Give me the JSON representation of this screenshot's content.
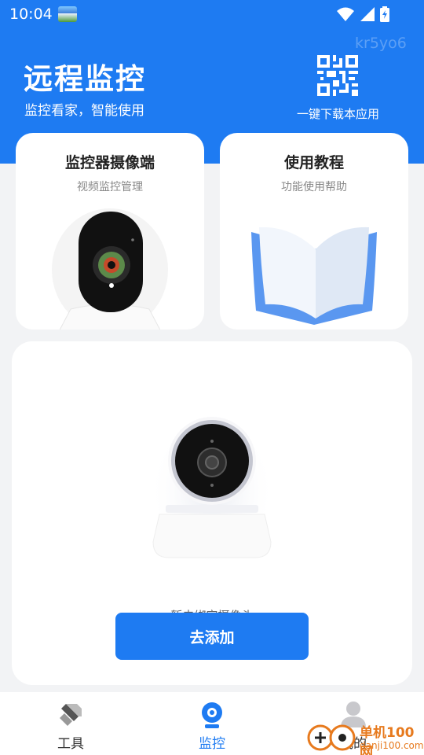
{
  "status_bar": {
    "time": "10:04"
  },
  "watermark_id": "kr5yo6",
  "hero": {
    "title": "远程监控",
    "subtitle": "监控看家，智能使用",
    "qr_label": "一键下载本应用"
  },
  "cards": [
    {
      "title": "监控器摄像端",
      "subtitle": "视频监控管理",
      "icon": "camera-icon"
    },
    {
      "title": "使用教程",
      "subtitle": "功能使用帮助",
      "icon": "book-icon"
    }
  ],
  "main": {
    "text": "暂未绑定摄像头",
    "button_label": "去添加"
  },
  "tabbar": {
    "items": [
      {
        "label": "工具",
        "icon": "ruler-icon",
        "active": false
      },
      {
        "label": "监控",
        "icon": "webcam-icon",
        "active": true
      },
      {
        "label": "我的",
        "icon": "user-icon",
        "active": false
      }
    ]
  },
  "watermark": {
    "line1": "单机100网",
    "line2": "danji100.com"
  },
  "colors": {
    "primary": "#1e7bf2",
    "background": "#f2f3f5",
    "inactive_tab": "#333333",
    "watermark": "#e77a1e"
  }
}
